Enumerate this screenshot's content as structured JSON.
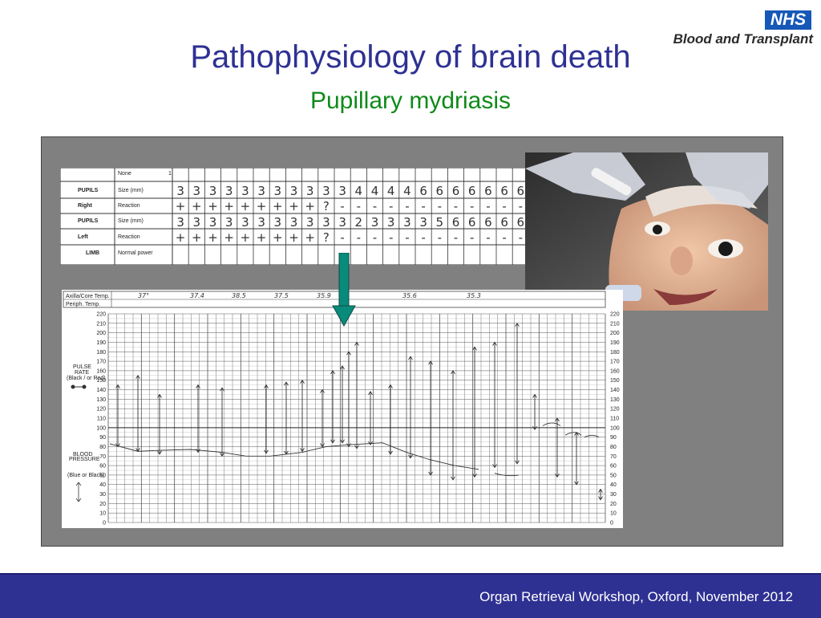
{
  "logo": {
    "nhs": "NHS",
    "org": "Blood and Transplant"
  },
  "title": "Pathophysiology of brain death",
  "subtitle": "Pupillary mydriasis",
  "observation_chart": {
    "rows": [
      {
        "group": "",
        "label": "None",
        "extra": "1"
      },
      {
        "group": "PUPILS",
        "label": "Size (mm)"
      },
      {
        "group": "Right",
        "label": "Reaction"
      },
      {
        "group": "PUPILS",
        "label": "Size (mm)"
      },
      {
        "group": "Left",
        "label": "Reaction"
      },
      {
        "group": "LIMB",
        "label": "Normal power"
      }
    ],
    "right_size": [
      "3",
      "3",
      "3",
      "3",
      "3",
      "3",
      "3",
      "3",
      "3",
      "3",
      "3",
      "4",
      "4",
      "4",
      "4",
      "6",
      "6",
      "6",
      "6",
      "6",
      "6",
      "6",
      "6"
    ],
    "right_reaction": [
      "+",
      "+",
      "+",
      "+",
      "+",
      "+",
      "+",
      "+",
      "+",
      "?",
      "-",
      "-",
      "-",
      "-",
      "-",
      "-",
      "-",
      "-",
      "-",
      "-",
      "-",
      "-",
      "-"
    ],
    "left_size": [
      "3",
      "3",
      "3",
      "3",
      "3",
      "3",
      "3",
      "3",
      "3",
      "3",
      "3",
      "2",
      "3",
      "3",
      "3",
      "3",
      "5",
      "6",
      "6",
      "6",
      "6",
      "6",
      "6"
    ],
    "left_reaction": [
      "+",
      "+",
      "+",
      "+",
      "+",
      "+",
      "+",
      "+",
      "+",
      "?",
      "-",
      "-",
      "-",
      "-",
      "-",
      "-",
      "-",
      "-",
      "-",
      "-",
      "-",
      "-",
      "-"
    ]
  },
  "vitals_chart": {
    "core_temp_label": "Axilla/Core Temp.",
    "periph_temp_label": "Periph. Temp.",
    "temps": [
      "37°",
      "37.4",
      "38.5",
      "37.5",
      "35.9",
      "35.6",
      "35.3"
    ],
    "pulse_label_1": "PULSE",
    "pulse_label_2": "RATE",
    "pulse_label_3": "(Black / or Red)",
    "bp_label_1": "BLOOD",
    "bp_label_2": "PRESSURE",
    "bp_label_3": "(Blue or Black)",
    "scale": [
      "220",
      "210",
      "200",
      "190",
      "180",
      "170",
      "160",
      "150",
      "140",
      "130",
      "120",
      "110",
      "100",
      "90",
      "80",
      "70",
      "60",
      "50",
      "40",
      "30",
      "20",
      "10",
      "0"
    ]
  },
  "footer": "Organ Retrieval Workshop, Oxford, November 2012",
  "colors": {
    "title": "#2e3192",
    "subtitle": "#0f8a1a",
    "footer_bg": "#2e3192",
    "panel": "#808080",
    "arrow": "#0a8a7a",
    "nhs_blue": "#1658b8"
  }
}
